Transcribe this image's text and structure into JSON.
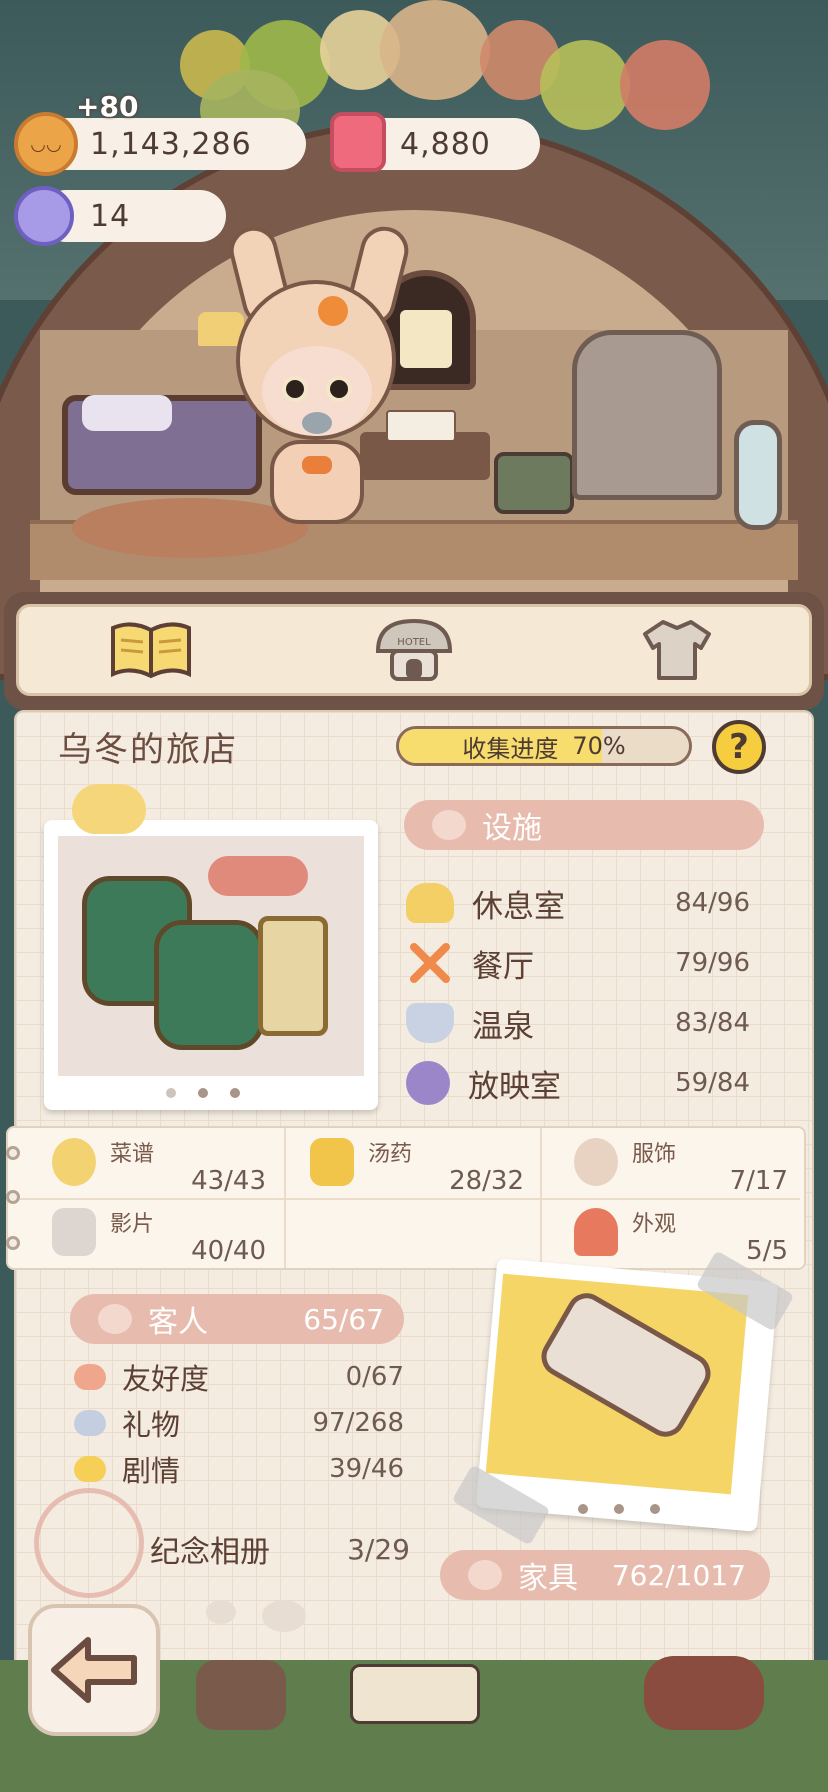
{
  "currency": {
    "coins": "1,143,286",
    "coin_gain": "+80",
    "candles": "4,880",
    "gems": "14"
  },
  "tabs": [
    {
      "name": "collection-book",
      "icon": "open-book-icon",
      "active": true
    },
    {
      "name": "hotel",
      "icon": "hotel-mushroom-icon",
      "icon_text": "HOTEL",
      "active": false
    },
    {
      "name": "outfit",
      "icon": "shirt-icon",
      "active": false
    }
  ],
  "inn": {
    "title": "乌冬的旅店",
    "progress_label": "收集进度",
    "progress_value": "70%",
    "progress_fraction": 0.7,
    "help": "?"
  },
  "facilities": {
    "header": "设施",
    "items": [
      {
        "name": "休息室",
        "count": "84/96",
        "icon": "cloud-icon",
        "color": "#f3cf66"
      },
      {
        "name": "餐厅",
        "count": "79/96",
        "icon": "fork-knife-icon",
        "color": "#f08a4b"
      },
      {
        "name": "温泉",
        "count": "83/84",
        "icon": "hot-spring-icon",
        "color": "#b8c4d8"
      },
      {
        "name": "放映室",
        "count": "59/84",
        "icon": "film-reel-icon",
        "color": "#9b86c9"
      }
    ]
  },
  "categories": [
    {
      "name": "菜谱",
      "count": "43/43",
      "icon": "dish-icon"
    },
    {
      "name": "汤药",
      "count": "28/32",
      "icon": "potion-jar-icon"
    },
    {
      "name": "服饰",
      "count": "7/17",
      "icon": "costume-icon"
    },
    {
      "name": "影片",
      "count": "40/40",
      "icon": "clapperboard-icon"
    },
    {
      "name": "外观",
      "count": "5/5",
      "icon": "house-icon"
    }
  ],
  "guests": {
    "header": "客人",
    "header_count": "65/67",
    "items": [
      {
        "name": "友好度",
        "count": "0/67",
        "color": "#f0a68d"
      },
      {
        "name": "礼物",
        "count": "97/268",
        "color": "#c5cde0"
      },
      {
        "name": "剧情",
        "count": "39/46",
        "color": "#f5cf56"
      }
    ]
  },
  "album": {
    "label": "纪念相册",
    "count": "3/29"
  },
  "furniture": {
    "label": "家具",
    "count": "762/1017"
  },
  "colors": {
    "accent": "#e7bcae",
    "brand_brown": "#6e5246",
    "paper": "#f4ece0"
  }
}
